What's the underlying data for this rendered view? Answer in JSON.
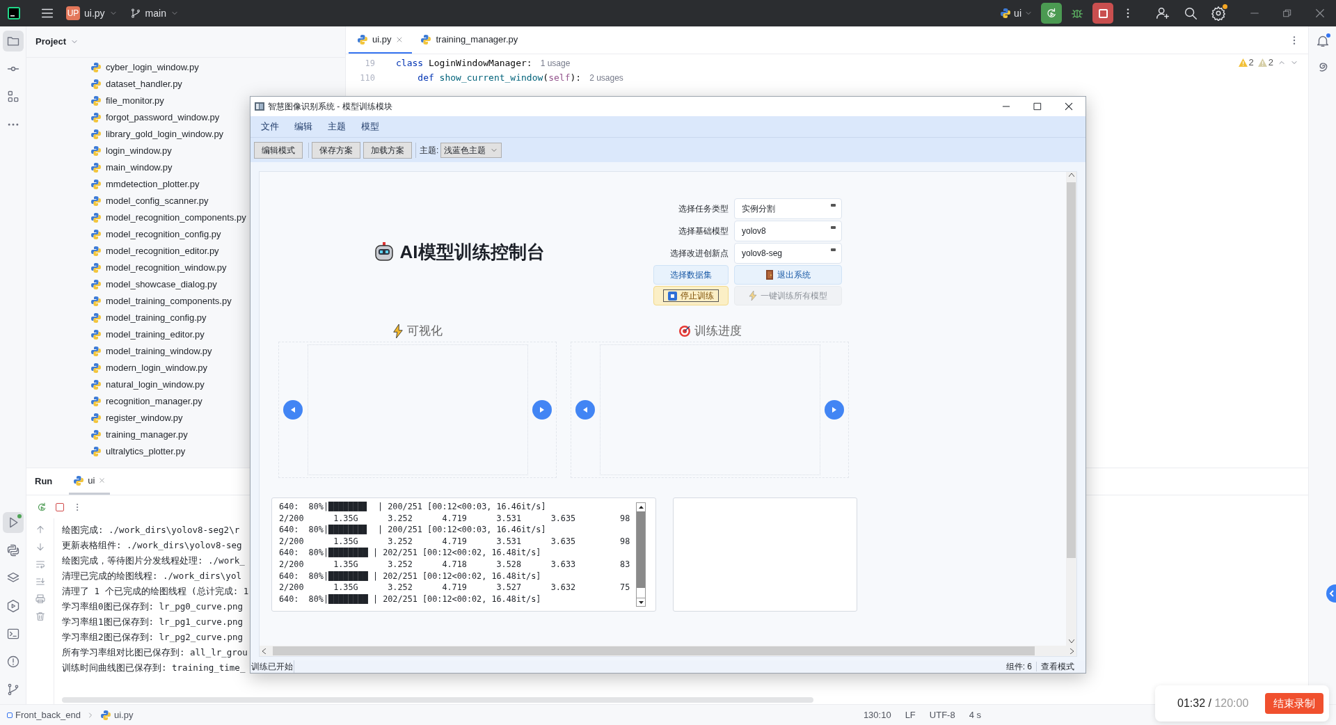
{
  "topbar": {
    "project_badge": "UP",
    "project": "ui.py",
    "branch": "main",
    "run_config": "ui"
  },
  "project_panel": {
    "title": "Project",
    "files": [
      "cyber_login_window.py",
      "dataset_handler.py",
      "file_monitor.py",
      "forgot_password_window.py",
      "library_gold_login_window.py",
      "login_window.py",
      "main_window.py",
      "mmdetection_plotter.py",
      "model_config_scanner.py",
      "model_recognition_components.py",
      "model_recognition_config.py",
      "model_recognition_editor.py",
      "model_recognition_window.py",
      "model_showcase_dialog.py",
      "model_training_components.py",
      "model_training_config.py",
      "model_training_editor.py",
      "model_training_window.py",
      "modern_login_window.py",
      "natural_login_window.py",
      "recognition_manager.py",
      "register_window.py",
      "training_manager.py",
      "ultralytics_plotter.py"
    ]
  },
  "editor": {
    "tabs": [
      {
        "label": "ui.py",
        "selected": true
      },
      {
        "label": "training_manager.py",
        "selected": false
      }
    ],
    "lines": [
      {
        "number": "19",
        "parts": [
          {
            "kind": "keyword",
            "text": "class"
          },
          {
            "kind": "plain",
            "text": " LoginWindowManager:"
          }
        ],
        "hint": "1 usage"
      },
      {
        "number": "110",
        "parts": [
          {
            "kind": "keyword",
            "text": "    def"
          },
          {
            "kind": "function",
            "text": " show_current_window"
          },
          {
            "kind": "plain",
            "text": "("
          },
          {
            "kind": "self",
            "text": "self"
          },
          {
            "kind": "plain",
            "text": "):"
          }
        ],
        "hint": "2 usages"
      }
    ],
    "inspections": [
      {
        "kind": "warning",
        "count": "2"
      },
      {
        "kind": "weak_warning",
        "count": "2"
      }
    ]
  },
  "run_panel": {
    "title": "Run",
    "tab": "ui",
    "console": [
      "绘图完成: ./work_dirs\\yolov8-seg2\\r",
      "更新表格组件: ./work_dirs\\yolov8-seg",
      "绘图完成，等待图片分发线程处理: ./work_",
      "清理已完成的绘图线程: ./work_dirs\\yol",
      "清理了 1 个已完成的绘图线程 (总计完成: 1",
      "学习率组0图已保存到: lr_pg0_curve.png",
      "学习率组1图已保存到: lr_pg1_curve.png",
      "学习率组2图已保存到: lr_pg2_curve.png",
      "所有学习率组对比图已保存到: all_lr_grou",
      "训练时间曲线图已保存到: training_time_"
    ]
  },
  "status_bar": {
    "breadcrumbs": [
      "Front_back_end",
      "ui.py"
    ],
    "items": [
      "130:10",
      "LF",
      "UTF-8",
      "4 s"
    ]
  },
  "dialog": {
    "title": "智慧图像识别系统 - 模型训练模块",
    "menu": [
      "文件",
      "编辑",
      "主题",
      "模型"
    ],
    "toolbar": [
      "编辑模式",
      "保存方案",
      "加载方案"
    ],
    "theme": {
      "label": "主题:",
      "value": "浅蓝色主题"
    },
    "heading": "AI模型训练控制台",
    "form": [
      {
        "label": "选择任务类型",
        "value": "实例分割"
      },
      {
        "label": "选择基础模型",
        "value": "yolov8"
      },
      {
        "label": "选择改进创新点",
        "value": "yolov8-seg"
      }
    ],
    "actions": [
      {
        "kind": "dataset",
        "label": "选择数据集",
        "disabled": false
      },
      {
        "kind": "exit",
        "label": "退出系统",
        "disabled": false
      },
      {
        "kind": "stop",
        "label": "停止训练",
        "disabled": false
      },
      {
        "kind": "train_all",
        "label": "一键训练所有模型",
        "disabled": true
      }
    ],
    "sections": [
      {
        "kind": "visual",
        "title": "可视化"
      },
      {
        "kind": "progress",
        "title": "训练进度"
      }
    ],
    "log": [
      "640:  80%|███████▊  | 200/251 [00:12<00:03, 16.46it/s]",
      "2/200      1.35G      3.252      4.719      3.531      3.635         98",
      "640:  80%|███████▊  | 200/251 [00:12<00:03, 16.46it/s]",
      "2/200      1.35G      3.252      4.719      3.531      3.635         98",
      "640:  80%|████████ | 202/251 [00:12<00:02, 16.48it/s]",
      "2/200      1.35G      3.252      4.718      3.528      3.633         83",
      "640:  80%|████████ | 202/251 [00:12<00:02, 16.48it/s]",
      "2/200      1.35G      3.252      4.719      3.527      3.632         75",
      "640:  80%|████████ | 202/251 [00:12<00:02, 16.48it/s]"
    ],
    "status": "训练已开始",
    "status_items": [
      "组件: 6",
      "查看模式"
    ]
  },
  "recording": {
    "elapsed": "01:32 /",
    "limit": "120:00",
    "button": "结束录制"
  }
}
